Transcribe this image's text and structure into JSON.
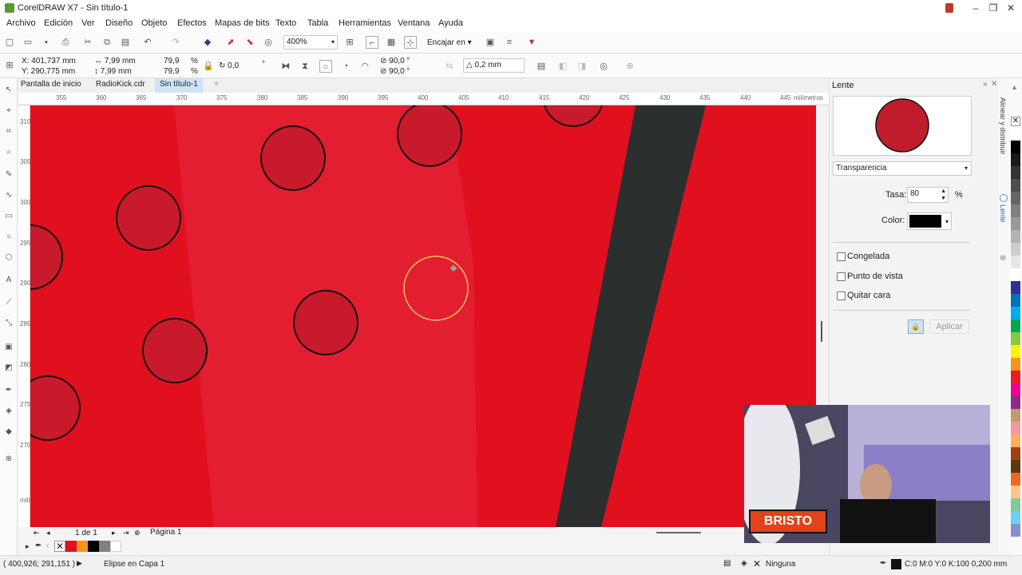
{
  "app": {
    "title": "CorelDRAW X7 - Sin título-1"
  },
  "menu": [
    "Archivo",
    "Edición",
    "Ver",
    "Diseño",
    "Objeto",
    "Efectos",
    "Mapas de bits",
    "Texto",
    "Tabla",
    "Herramientas",
    "Ventana",
    "Ayuda"
  ],
  "toolbar": {
    "zoom": "400%",
    "snap_label": "Encajar en"
  },
  "props": {
    "x": "X: 401,737 mm",
    "y": "Y: 290,775 mm",
    "w": "7,99 mm",
    "h": "7,99 mm",
    "sx": "79,9",
    "sy": "79,9",
    "pct": "%",
    "rot": "0,0",
    "deg": "°",
    "angle1": "90,0 °",
    "angle2": "90,0 °",
    "outline": "0,2 mm"
  },
  "doc_tabs": [
    "Pantalla de inicio",
    "RadioKick.cdr",
    "Sin título-1"
  ],
  "ruler": {
    "h_ticks": [
      "355",
      "360",
      "365",
      "370",
      "375",
      "380",
      "385",
      "390",
      "395",
      "400",
      "405",
      "410",
      "415",
      "420",
      "425",
      "430",
      "435",
      "440",
      "445"
    ],
    "h_unit": "milímetros",
    "v_ticks": [
      "310",
      "305",
      "300",
      "295",
      "290",
      "285",
      "280",
      "275",
      "270"
    ],
    "v_unit": "milímetros"
  },
  "pager": {
    "page_count": "1 de 1",
    "page_name": "Página 1"
  },
  "panel": {
    "title": "Lente",
    "lens_type": "Transparencia",
    "rate_label": "Tasa:",
    "rate_value": "80",
    "rate_unit": "%",
    "color_label": "Color:",
    "color_value": "#000000",
    "options": [
      "Congelada",
      "Punto de vista",
      "Quitar cara"
    ],
    "apply_label": "Aplicar"
  },
  "side_tabs": [
    "Alinear y distribuir",
    "Lente"
  ],
  "status": {
    "coords": "( 400,926; 291,151 )",
    "object": "Elipse en Capa 1",
    "fill": "Ninguna",
    "outline": "C:0 M:0 Y:0 K:100  0,200 mm"
  },
  "webcam": {
    "logo_text": "BRISTO"
  },
  "colors": {
    "canvas_red": "#e1101f",
    "stripe_dark": "#2b2f2e",
    "accent_blue": "#cfe3f7"
  },
  "palette_colors": [
    "#ffffff",
    "#000000",
    "#1a1a1a",
    "#333333",
    "#4d4d4d",
    "#666666",
    "#808080",
    "#999999",
    "#b3b3b3",
    "#cccccc",
    "#e6e6e6",
    "#ffffff",
    "#2e3192",
    "#0072bc",
    "#00aeef",
    "#00a651",
    "#8dc63f",
    "#fff200",
    "#f7941d",
    "#ed1c24",
    "#ec008c",
    "#92278f",
    "#c49a6c",
    "#f5989d",
    "#fbaf5d",
    "#a0410d",
    "#603913",
    "#f26522",
    "#fdc689",
    "#82ca9c",
    "#6dcff6",
    "#8393ca"
  ],
  "doc_palette": [
    "#ffffff",
    "#e1101f",
    "#f7941d",
    "#000000",
    "#808080",
    "#ffffff"
  ]
}
